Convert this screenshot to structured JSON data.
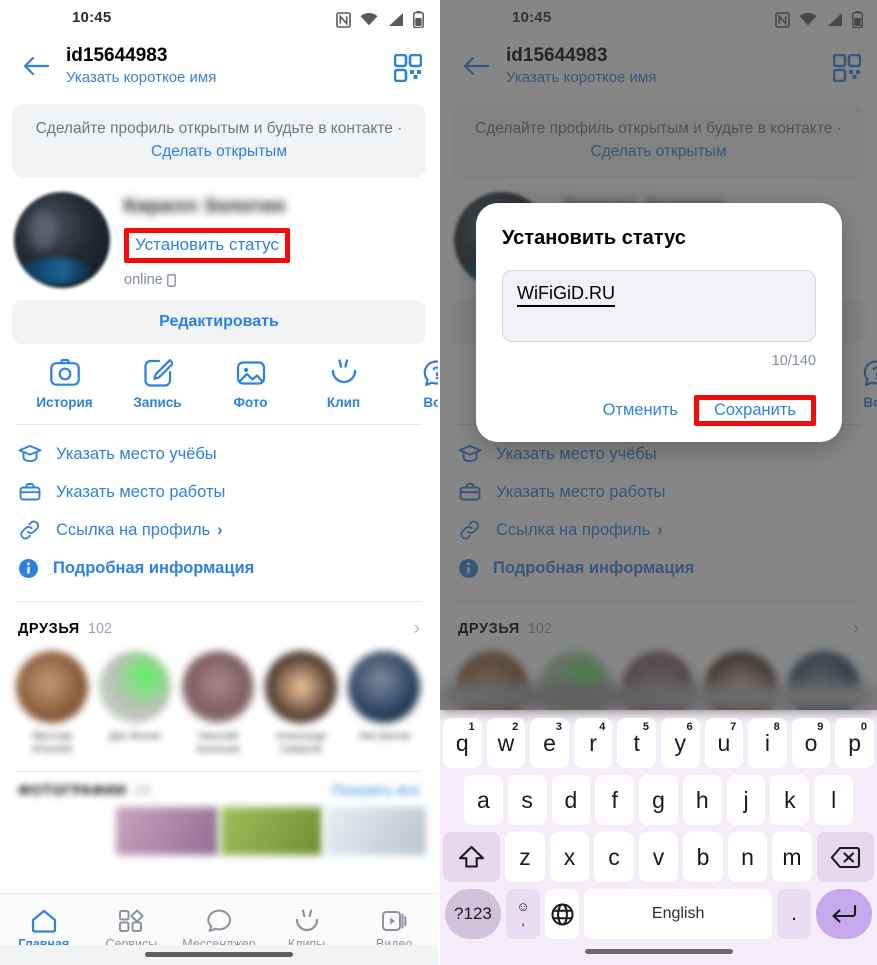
{
  "statusbar": {
    "time": "10:45",
    "icons": [
      "nfc-icon",
      "wifi-icon",
      "signal-icon",
      "battery-icon"
    ]
  },
  "header": {
    "title": "id15644983",
    "subtitle": "Указать короткое имя",
    "back_icon": "back-arrow-icon",
    "qr_icon": "qr-code-icon"
  },
  "banner": {
    "text": "Сделайте профиль открытым и будьте в контакте · ",
    "link": "Сделать открытым"
  },
  "profile": {
    "name": "Кирилл Золотин",
    "set_status": "Установить статус",
    "online": "online",
    "online_device_icon": "phone-icon",
    "edit_button": "Редактировать"
  },
  "actions": [
    {
      "label": "История",
      "icon": "camera-icon"
    },
    {
      "label": "Запись",
      "icon": "pencil-square-icon"
    },
    {
      "label": "Фото",
      "icon": "photo-icon"
    },
    {
      "label": "Клип",
      "icon": "clip-icon"
    },
    {
      "label": "Воп",
      "icon": "question-bubble-icon"
    }
  ],
  "info_rows": [
    {
      "label": "Указать место учёбы",
      "icon": "graduation-cap-icon",
      "chevron": "",
      "bold": false
    },
    {
      "label": "Указать место работы",
      "icon": "briefcase-icon",
      "chevron": "",
      "bold": false
    },
    {
      "label": "Ссылка на профиль",
      "icon": "link-icon",
      "chevron": "›",
      "bold": false
    },
    {
      "label": "Подробная информация",
      "icon": "info-circle-icon",
      "chevron": "",
      "bold": true
    }
  ],
  "friends": {
    "title": "ДРУЗЬЯ",
    "count": "102",
    "chevron": "›",
    "items": [
      {
        "name": "Ярослав Ильичёв"
      },
      {
        "name": "Дан Жилин"
      },
      {
        "name": "Николай Кузнецов"
      },
      {
        "name": "Александр Смирнов"
      },
      {
        "name": "Лев Шилов"
      }
    ]
  },
  "photos": {
    "title": "ФОТОГРАФИИ",
    "count": "24",
    "link": "Показать все"
  },
  "bottom_nav": [
    {
      "label": "Главная",
      "icon": "home-icon",
      "active": true
    },
    {
      "label": "Сервисы",
      "icon": "services-grid-icon",
      "active": false
    },
    {
      "label": "Мессенджер",
      "icon": "chat-bubble-icon",
      "active": false
    },
    {
      "label": "Клипы",
      "icon": "clips-icon",
      "active": false
    },
    {
      "label": "Видео",
      "icon": "video-icon",
      "active": false
    }
  ],
  "dialog": {
    "title": "Установить статус",
    "input_value": "WiFiGiD.RU",
    "counter": "10/140",
    "cancel": "Отменить",
    "save": "Сохранить"
  },
  "keyboard": {
    "row1": [
      {
        "key": "q",
        "sup": "1"
      },
      {
        "key": "w",
        "sup": "2"
      },
      {
        "key": "e",
        "sup": "3"
      },
      {
        "key": "r",
        "sup": "4"
      },
      {
        "key": "t",
        "sup": "5"
      },
      {
        "key": "y",
        "sup": "6"
      },
      {
        "key": "u",
        "sup": "7"
      },
      {
        "key": "i",
        "sup": "8"
      },
      {
        "key": "o",
        "sup": "9"
      },
      {
        "key": "p",
        "sup": "0"
      }
    ],
    "row2": [
      "a",
      "s",
      "d",
      "f",
      "g",
      "h",
      "j",
      "k",
      "l"
    ],
    "row3": [
      "z",
      "x",
      "c",
      "v",
      "b",
      "n",
      "m"
    ],
    "shift_icon": "shift-icon",
    "backspace_icon": "backspace-icon",
    "numbers_key": "?123",
    "emoji_key": "☺",
    "comma_key": ",",
    "globe_icon": "globe-icon",
    "space_label": "English",
    "period_key": ".",
    "enter_icon": "enter-icon"
  },
  "colors": {
    "accent": "#2d81e0",
    "highlight": "#f60a0a",
    "muted": "#818c99",
    "panel": "#f2f3f5",
    "keyboard_bg": "#f4ecf6"
  }
}
